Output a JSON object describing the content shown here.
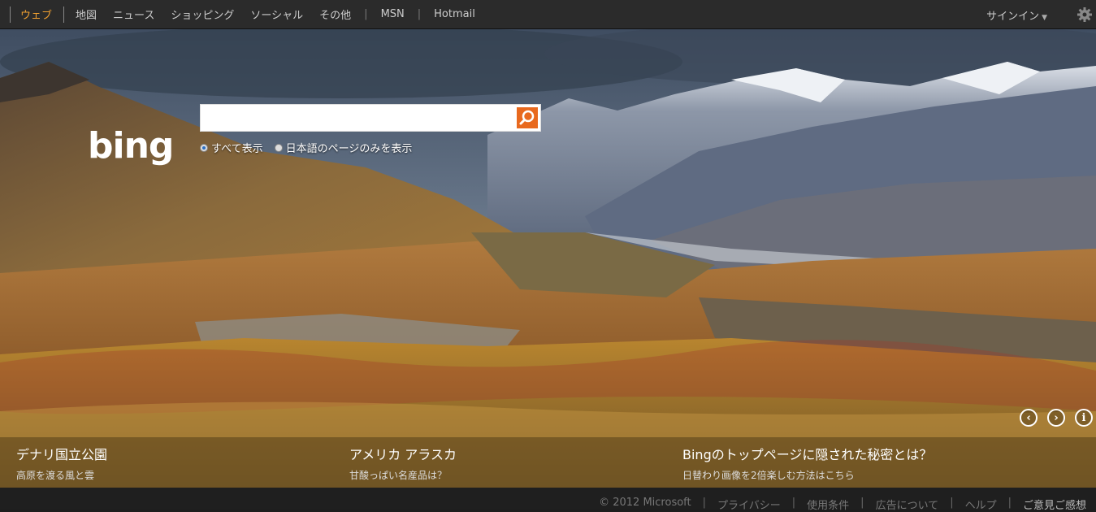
{
  "nav": {
    "items": [
      {
        "label": "ウェブ"
      },
      {
        "label": "地図"
      },
      {
        "label": "ニュース"
      },
      {
        "label": "ショッピング"
      },
      {
        "label": "ソーシャル"
      },
      {
        "label": "その他"
      },
      {
        "label": "MSN"
      },
      {
        "label": "Hotmail"
      }
    ],
    "signin": "サインイン",
    "accent": "#f0a030"
  },
  "search": {
    "value": "",
    "placeholder": "",
    "button_color": "#e8691e",
    "options": [
      {
        "label": "すべて表示",
        "selected": true
      },
      {
        "label": "日本語のページのみを表示",
        "selected": false
      }
    ]
  },
  "logo_text": "bing",
  "captions": [
    {
      "title": "デナリ国立公園",
      "subtitle": "高原を渡る風と雲"
    },
    {
      "title": "アメリカ アラスカ",
      "subtitle": "甘酸っぱい名産品は？"
    },
    {
      "title": "Bingのトップページに隠された秘密とは？",
      "subtitle": "日替わり画像を2倍楽しむ方法はこちら"
    }
  ],
  "footer": {
    "links": [
      "© 2012 Microsoft",
      "プライバシー",
      "使用条件",
      "広告について",
      "ヘルプ",
      "ご意見ご感想"
    ]
  }
}
